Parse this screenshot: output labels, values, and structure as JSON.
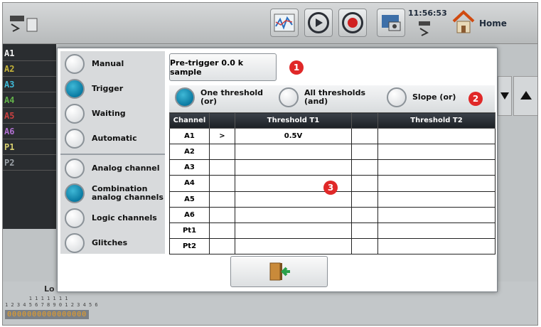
{
  "header": {
    "clock": "11:56:53",
    "home_label": "Home"
  },
  "channels": [
    {
      "label": "A1",
      "color": "#f2f2f2"
    },
    {
      "label": "A2",
      "color": "#c6b43a"
    },
    {
      "label": "A3",
      "color": "#3fb8d6"
    },
    {
      "label": "A4",
      "color": "#63b04a"
    },
    {
      "label": "A5",
      "color": "#c84040"
    },
    {
      "label": "A6",
      "color": "#b070d0"
    },
    {
      "label": "P1",
      "color": "#d8d070"
    },
    {
      "label": "P2",
      "color": "#9aa0a6"
    }
  ],
  "bottom": {
    "label": "Lo",
    "digits_top": "        1 1 1 1 1 1 1",
    "digits_mid": "1 2 3 4 5 6 7 8 9 0 1 2 3 4 5 6",
    "digits_bottom": "0000000000000000"
  },
  "dialog": {
    "mode_items": [
      {
        "label": "Manual",
        "selected": false
      },
      {
        "label": "Trigger",
        "selected": true
      },
      {
        "label": "Waiting",
        "selected": false
      },
      {
        "label": "Automatic",
        "selected": false
      }
    ],
    "source_items": [
      {
        "label": "Analog channel",
        "selected": false
      },
      {
        "label": "Combination analog channels",
        "selected": true
      },
      {
        "label": "Logic channels",
        "selected": false
      },
      {
        "label": "Glitches",
        "selected": false
      }
    ],
    "pretrigger_label": "Pre-trigger 0.0 k sample",
    "badges": [
      "1",
      "2",
      "3"
    ],
    "threshold_options": [
      {
        "label": "One threshold (or)",
        "selected": true
      },
      {
        "label": "All thresholds (and)",
        "selected": false
      },
      {
        "label": "Slope (or)",
        "selected": false
      }
    ],
    "table": {
      "headers": [
        "Channel",
        "",
        "Threshold T1",
        "",
        "Threshold T2"
      ],
      "rows": [
        [
          "A1",
          ">",
          "0.5V",
          "",
          ""
        ],
        [
          "A2",
          "",
          "",
          "",
          ""
        ],
        [
          "A3",
          "",
          "",
          "",
          ""
        ],
        [
          "A4",
          "",
          "",
          "",
          ""
        ],
        [
          "A5",
          "",
          "",
          "",
          ""
        ],
        [
          "A6",
          "",
          "",
          "",
          ""
        ],
        [
          "Pt1",
          "",
          "",
          "",
          ""
        ],
        [
          "Pt2",
          "",
          "",
          "",
          ""
        ]
      ]
    }
  }
}
